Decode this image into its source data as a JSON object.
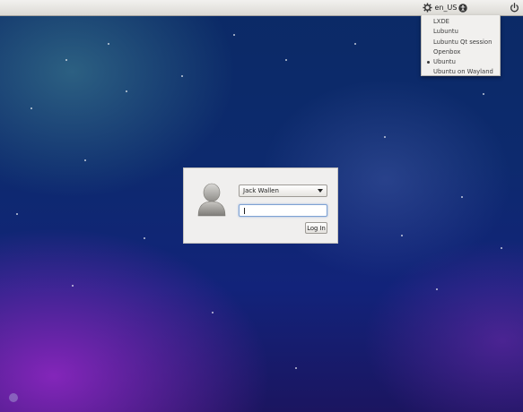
{
  "topbar": {
    "language": "en_US",
    "icons": [
      "session-icon",
      "accessibility-icon",
      "power-icon"
    ]
  },
  "session_menu": {
    "items": [
      {
        "label": "LXDE",
        "selected": false
      },
      {
        "label": "Lubuntu",
        "selected": false
      },
      {
        "label": "Lubuntu Qt session",
        "selected": false
      },
      {
        "label": "Openbox",
        "selected": false
      },
      {
        "label": "Ubuntu",
        "selected": true
      },
      {
        "label": "Ubuntu on Wayland",
        "selected": false
      }
    ]
  },
  "login": {
    "user": "Jack Wallen",
    "password": "",
    "button_label": "Log In"
  },
  "colors": {
    "panel": "#dcdad5",
    "menu_bg": "#f1f0ee",
    "desktop_top": "#0b2a66",
    "desktop_purple": "#9628c8"
  }
}
